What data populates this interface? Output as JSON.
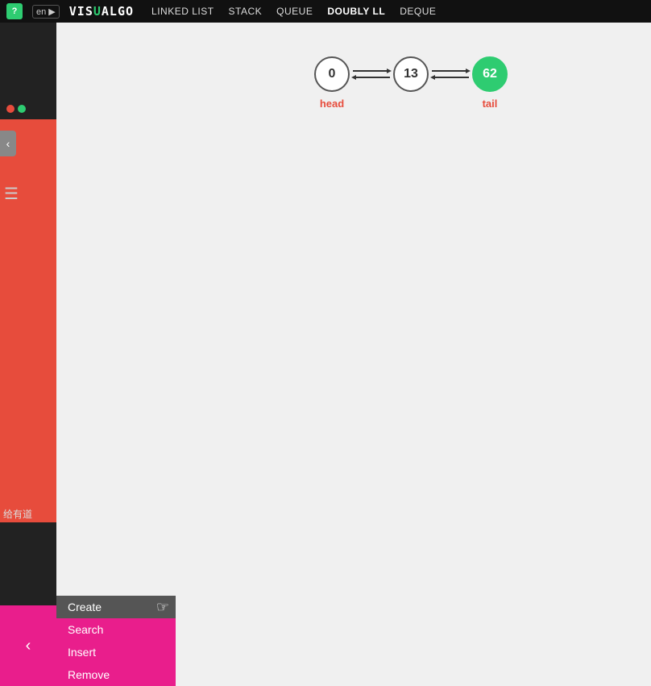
{
  "navbar": {
    "logo_icon": "?",
    "lang": "en ▶",
    "brand": "VISUALGO",
    "brand_vis": "VIS",
    "brand_u": "U",
    "brand_al": "AL",
    "brand_go": "GO",
    "links": [
      {
        "label": "LINKED LIST",
        "active": false
      },
      {
        "label": "STACK",
        "active": false
      },
      {
        "label": "QUEUE",
        "active": false
      },
      {
        "label": "DOUBLY LL",
        "active": true
      },
      {
        "label": "DEQUE",
        "active": false
      }
    ]
  },
  "list_nodes": [
    {
      "value": "0",
      "label": "head",
      "type": "normal"
    },
    {
      "value": "13",
      "label": "",
      "type": "normal"
    },
    {
      "value": "62",
      "label": "tail",
      "type": "tail"
    }
  ],
  "context_menu": {
    "items": [
      {
        "label": "Create",
        "style": "create"
      },
      {
        "label": "Search",
        "style": "search"
      },
      {
        "label": "Insert",
        "style": "insert"
      },
      {
        "label": "Remove",
        "style": "remove"
      }
    ]
  },
  "sidebar": {
    "chinese_text": "给有道"
  },
  "toggle": {
    "arrow": "‹"
  }
}
